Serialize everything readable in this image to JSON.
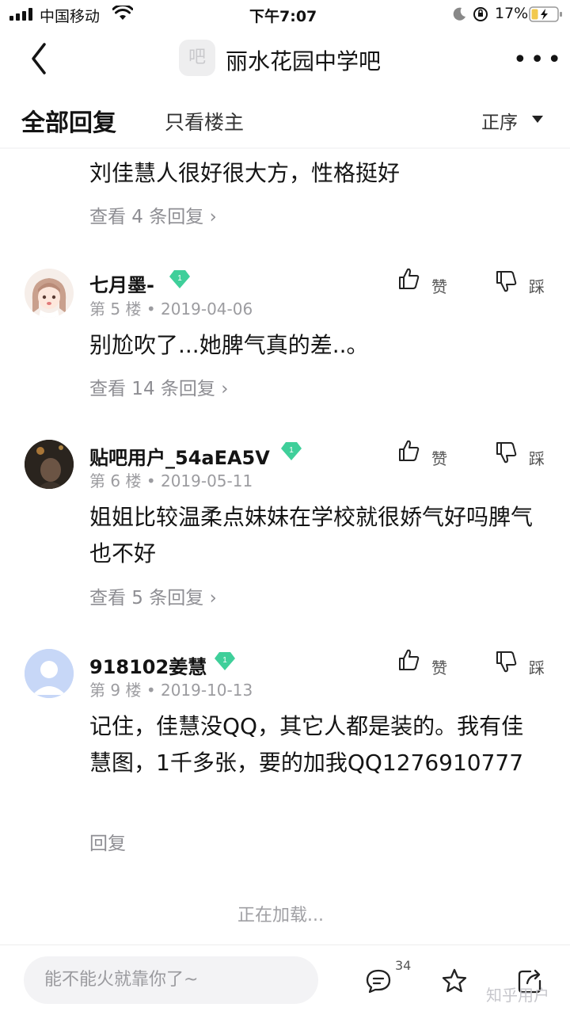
{
  "status_bar": {
    "carrier": "中国移动",
    "time": "下午7:07",
    "battery": "17%"
  },
  "header": {
    "forum_icon": "吧",
    "title": "丽水花园中学吧",
    "more": "•••"
  },
  "tabs": {
    "all": "全部回复",
    "owner_only": "只看楼主",
    "sort": "正序"
  },
  "posts": [
    {
      "content": "刘佳慧人很好很大方，性格挺好",
      "replies": "查看 4 条回复 ›"
    },
    {
      "username": "七月墨-",
      "floor": "第 5 楼",
      "date": "2019-04-06",
      "content": "别尬吹了...她脾气真的差..。",
      "replies": "查看 14 条回复 ›",
      "like": "赞",
      "dislike": "踩"
    },
    {
      "username": "贴吧用户_54aEA5V",
      "floor": "第 6 楼",
      "date": "2019-05-11",
      "content": "姐姐比较温柔点妹妹在学校就很娇气好吗脾气也不好",
      "replies": "查看 5 条回复 ›",
      "like": "赞",
      "dislike": "踩"
    },
    {
      "username": "918102姜慧",
      "floor": "第 9 楼",
      "date": "2019-10-13",
      "content": "记住，佳慧没QQ，其它人都是装的。我有佳慧图，1千多张，要的加我QQ1276910777",
      "replies": "回复",
      "like": "赞",
      "dislike": "踩"
    }
  ],
  "loading": "正在加载...",
  "bottom_bar": {
    "input_placeholder": "能不能火就靠你了~",
    "comment_count": "34",
    "watermark": "知乎用户"
  },
  "icons": {
    "badge_color": "#3fcf9a",
    "accent": "#141414"
  }
}
